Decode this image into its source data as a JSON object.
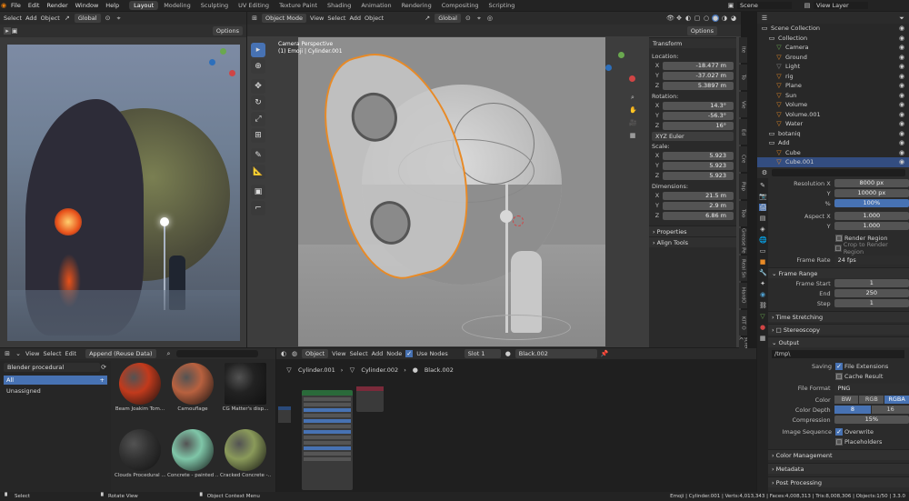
{
  "topbar": {
    "menus": [
      "File",
      "Edit",
      "Render",
      "Window",
      "Help"
    ],
    "workspaces": [
      "Layout",
      "Modeling",
      "Sculpting",
      "UV Editing",
      "Texture Paint",
      "Shading",
      "Animation",
      "Rendering",
      "Compositing",
      "Scripting"
    ],
    "active_workspace": "Layout",
    "scene_label": "Scene",
    "view_layer_label": "View Layer"
  },
  "left_viewport": {
    "menus": [
      "Select",
      "Add",
      "Object"
    ],
    "orientation": "Global",
    "options_label": "Options"
  },
  "main_viewport": {
    "mode": "Object Mode",
    "menus": [
      "View",
      "Select",
      "Add",
      "Object"
    ],
    "orientation": "Global",
    "options_label": "Options",
    "overlay_title": "Camera Perspective",
    "overlay_subtitle": "(1) Emoji | Cylinder.001"
  },
  "n_panel": {
    "transform_title": "Transform",
    "location_label": "Location:",
    "location": [
      {
        "axis": "X",
        "value": "-18.477 m"
      },
      {
        "axis": "Y",
        "value": "-37.027 m"
      },
      {
        "axis": "Z",
        "value": "5.3897 m"
      }
    ],
    "rotation_label": "Rotation:",
    "rotation": [
      {
        "axis": "X",
        "value": "14.3°"
      },
      {
        "axis": "Y",
        "value": "-56.3°"
      },
      {
        "axis": "Z",
        "value": "16°"
      }
    ],
    "rotation_mode": "XYZ Euler",
    "scale_label": "Scale:",
    "scale": [
      {
        "axis": "X",
        "value": "5.923"
      },
      {
        "axis": "Y",
        "value": "5.923"
      },
      {
        "axis": "Z",
        "value": "5.923"
      }
    ],
    "dimensions_label": "Dimensions:",
    "dimensions": [
      {
        "axis": "X",
        "value": "21.5 m"
      },
      {
        "axis": "Y",
        "value": "2.9 m"
      },
      {
        "axis": "Z",
        "value": "6.86 m"
      }
    ],
    "properties_title": "Properties",
    "align_tools_title": "Align Tools",
    "side_tabs": [
      "Ite",
      "To",
      "Vie",
      "Ed",
      "Cre",
      "Pap",
      "Too",
      "Grease Pe",
      "Real Sn",
      "HardO",
      "KIT O",
      "Screencast K",
      "polygo"
    ]
  },
  "outliner": {
    "rows": [
      {
        "name": "Scene Collection",
        "indent": 0
      },
      {
        "name": "Collection",
        "indent": 1
      },
      {
        "name": "Camera",
        "indent": 2
      },
      {
        "name": "Ground",
        "indent": 2
      },
      {
        "name": "Light",
        "indent": 2
      },
      {
        "name": "rig",
        "indent": 2
      },
      {
        "name": "Plane",
        "indent": 2
      },
      {
        "name": "Sun",
        "indent": 2
      },
      {
        "name": "Volume",
        "indent": 2
      },
      {
        "name": "Volume.001",
        "indent": 2
      },
      {
        "name": "Water",
        "indent": 2
      },
      {
        "name": "botaniq",
        "indent": 1
      },
      {
        "name": "Add",
        "indent": 1
      },
      {
        "name": "Cube",
        "indent": 2
      },
      {
        "name": "Cube.001",
        "indent": 2
      }
    ]
  },
  "properties": {
    "resolution_x_label": "Resolution X",
    "resolution_x": "8000 px",
    "resolution_y_label": "Y",
    "resolution_y": "10000 px",
    "percent_label": "%",
    "percent": "100%",
    "aspect_x_label": "Aspect X",
    "aspect_x": "1.000",
    "aspect_y_label": "Y",
    "aspect_y": "1.000",
    "render_region": "Render Region",
    "crop_region": "Crop to Render Region",
    "frame_rate_label": "Frame Rate",
    "frame_rate": "24 fps",
    "frame_range_title": "Frame Range",
    "frame_start_label": "Frame Start",
    "frame_start": "1",
    "end_label": "End",
    "end": "250",
    "step_label": "Step",
    "step": "1",
    "time_stretching": "Time Stretching",
    "stereoscopy": "Stereoscopy",
    "output_title": "Output",
    "output_path": "/tmp\\",
    "saving_label": "Saving",
    "file_extensions": "File Extensions",
    "cache_result": "Cache Result",
    "file_format_label": "File Format",
    "file_format": "PNG",
    "color_label": "Color",
    "color_options": [
      "BW",
      "RGB",
      "RGBA"
    ],
    "color_depth_label": "Color Depth",
    "color_depth_options": [
      "8",
      "16"
    ],
    "compression_label": "Compression",
    "compression": "15%",
    "image_sequence_label": "Image Sequence",
    "overwrite": "Overwrite",
    "placeholders": "Placeholders",
    "color_management": "Color Management",
    "metadata": "Metadata",
    "post_processing": "Post Processing"
  },
  "asset_browser": {
    "menus": [
      "View",
      "Select",
      "Edit"
    ],
    "import_mode": "Append (Reuse Data)",
    "library": "Blender procedural",
    "catalogs": [
      "All",
      "Unassigned"
    ],
    "assets": [
      {
        "label": "Beam Joakim Tom...",
        "color": "#c23a1c"
      },
      {
        "label": "Camouflage",
        "color": "#b8613f"
      },
      {
        "label": "CG Matter's disp...",
        "color": "#222222"
      },
      {
        "label": "Clouds Procedural ...",
        "color": "#333333"
      },
      {
        "label": "Concrete - painted ...",
        "color": "#7fc6a8"
      },
      {
        "label": "Cracked Concrete -...",
        "color": "#8a9a5a"
      }
    ]
  },
  "node_editor": {
    "type": "Object",
    "menus": [
      "View",
      "Select",
      "Add",
      "Node"
    ],
    "use_nodes": "Use Nodes",
    "slot": "Slot 1",
    "material": "Black.002",
    "breadcrumbs": [
      "Cylinder.001",
      "Cylinder.002",
      "Black.002"
    ]
  },
  "statusbar": {
    "select": "Select",
    "rotate": "Rotate View",
    "context": "Object Context Menu",
    "stats": "Emoji | Cylinder.001 | Verts:4,013,343 | Faces:4,008,313 | Tris:8,008,306 | Objects:1/50 | 3.3.0"
  }
}
